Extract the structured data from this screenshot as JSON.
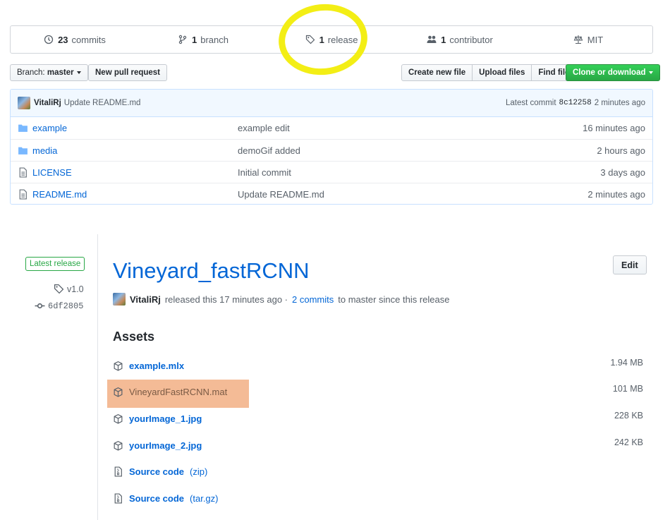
{
  "stats": [
    {
      "icon": "history-icon",
      "count": "23",
      "label": "commits"
    },
    {
      "icon": "branch-icon",
      "count": "1",
      "label": "branch"
    },
    {
      "icon": "tag-icon",
      "count": "1",
      "label": "release"
    },
    {
      "icon": "people-icon",
      "count": "1",
      "label": "contributor"
    },
    {
      "icon": "law-icon",
      "count": "",
      "label": "MIT"
    }
  ],
  "toolbar": {
    "branch_prefix": "Branch:",
    "branch_name": "master",
    "new_pr": "New pull request",
    "create_file": "Create new file",
    "upload": "Upload files",
    "find": "Find file",
    "clone": "Clone or download"
  },
  "commit": {
    "author": "VitaliRj",
    "message": "Update README.md",
    "latest_label": "Latest commit",
    "sha": "8c12258",
    "age": "2 minutes ago"
  },
  "files": [
    {
      "type": "folder",
      "name": "example",
      "message": "example edit",
      "age": "16 minutes ago"
    },
    {
      "type": "folder",
      "name": "media",
      "message": "demoGif added",
      "age": "2 hours ago"
    },
    {
      "type": "file",
      "name": "LICENSE",
      "message": "Initial commit",
      "age": "3 days ago"
    },
    {
      "type": "file",
      "name": "README.md",
      "message": "Update README.md",
      "age": "2 minutes ago"
    }
  ],
  "release": {
    "badge": "Latest release",
    "tag": "v1.0",
    "commit": "6df2805",
    "title": "Vineyard_fastRCNN",
    "edit": "Edit",
    "author": "VitaliRj",
    "released_text": "released this 17 minutes ago ·",
    "commits_link": "2 commits",
    "since_text": "to master since this release",
    "assets_heading": "Assets",
    "assets": [
      {
        "name": "example.mlx",
        "size": "1.94 MB"
      },
      {
        "name": "VineyardFastRCNN.mat",
        "size": "101 MB"
      },
      {
        "name": "yourImage_1.jpg",
        "size": "228 KB"
      },
      {
        "name": "yourImage_2.jpg",
        "size": "242 KB"
      }
    ],
    "sources": [
      {
        "name": "Source code",
        "ext": "(zip)"
      },
      {
        "name": "Source code",
        "ext": "(tar.gz)"
      }
    ]
  },
  "colors": {
    "link": "#0366d6",
    "green": "#28a745",
    "highlight_circle": "#f3ee15",
    "highlight_box": "#f4bb96"
  }
}
